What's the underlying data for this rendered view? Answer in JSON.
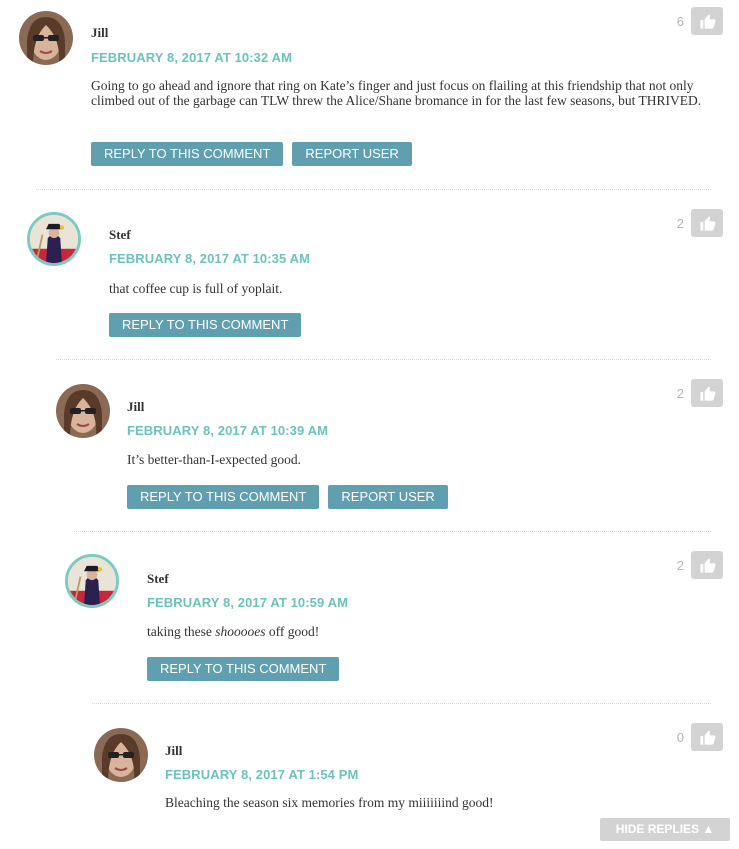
{
  "thumbs_icon": "thumbs-up-icon",
  "colors": {
    "date_teal": "#6cc3bc",
    "button_blue": "#5f9fb0",
    "like_gray": "#d3d3d3",
    "avatar_ring": "#7dc9c3"
  },
  "comments": [
    {
      "author": "Jill",
      "date": "FEBRUARY 8, 2017 AT 10:32 AM",
      "body": "Going to go ahead and ignore that ring on Kate’s finger and just focus on flailing at this friendship that not only climbed out of the garbage can TLW threw the Alice/Shane bromance in for the last few seasons, but THRIVED.",
      "likes": "6",
      "reply_label": "REPLY TO THIS COMMENT",
      "report_label": "REPORT USER"
    },
    {
      "author": "Stef",
      "date": "FEBRUARY 8, 2017 AT 10:35 AM",
      "body": "that coffee cup is full of yoplait.",
      "likes": "2",
      "reply_label": "REPLY TO THIS COMMENT"
    },
    {
      "author": "Jill",
      "date": "FEBRUARY 8, 2017 AT 10:39 AM",
      "body": "It’s better-than-I-expected good.",
      "likes": "2",
      "reply_label": "REPLY TO THIS COMMENT",
      "report_label": "REPORT USER"
    },
    {
      "author": "Stef",
      "date": "FEBRUARY 8, 2017 AT 10:59 AM",
      "body_before": "taking these ",
      "body_italic": "shooooes",
      "body_after": " off good!",
      "likes": "2",
      "reply_label": "REPLY TO THIS COMMENT"
    },
    {
      "author": "Jill",
      "date": "FEBRUARY 8, 2017 AT 1:54 PM",
      "body": "Bleaching the season six memories from my miiiiiiind good!",
      "likes": "0"
    }
  ],
  "hide_replies_label": "HIDE REPLIES ▲"
}
